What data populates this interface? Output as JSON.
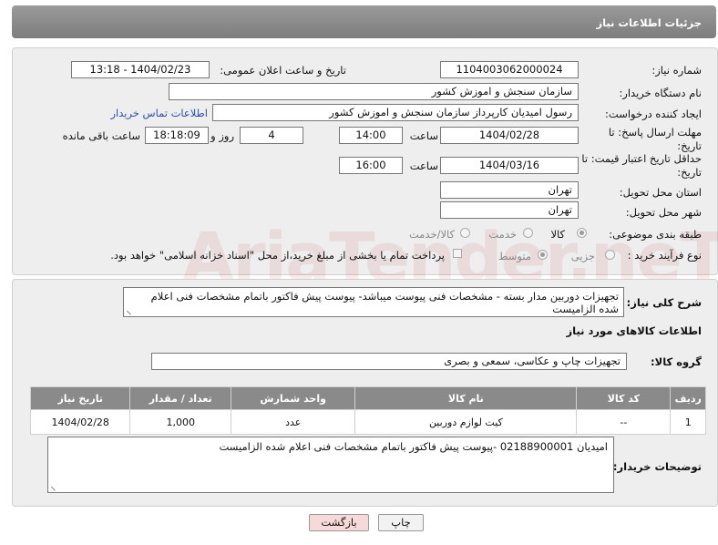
{
  "header": {
    "title": "جزئیات اطلاعات نیاز"
  },
  "form": {
    "need_number_label": "شماره نیاز:",
    "need_number": "1104003062000024",
    "announce_datetime_label": "تاریخ و ساعت اعلان عمومی:",
    "announce_datetime": "1404/02/23 - 13:18",
    "buyer_org_label": "نام دستگاه خریدار:",
    "buyer_org": "سازمان سنجش و اموزش کشور",
    "requester_label": "ایجاد کننده درخواست:",
    "requester": "رسول امیدیان کارپرداز سازمان سنجش و اموزش کشور",
    "buyer_contact_link": "اطلاعات تماس خریدار",
    "reply_deadline_label": "مهلت ارسال پاسخ: تا تاریخ:",
    "reply_deadline_date": "1404/02/28",
    "time_label": "ساعت",
    "reply_deadline_time": "14:00",
    "days_value": "4",
    "days_label": "روز و",
    "remaining_time": "18:18:09",
    "remaining_label": "ساعت باقی مانده",
    "price_validity_label": "حداقل تاریخ اعتبار قیمت: تا تاریخ:",
    "price_validity_date": "1404/03/16",
    "price_validity_time": "16:00",
    "delivery_province_label": "استان محل تحویل:",
    "delivery_province": "تهران",
    "delivery_city_label": "شهر محل تحویل:",
    "delivery_city": "تهران",
    "category_label": "طبقه بندی موضوعی:",
    "category_options": [
      "کالا",
      "خدمت",
      "کالا/خدمت"
    ],
    "category_selected": "کالا",
    "process_label": "نوع فرآیند خرید :",
    "process_options": [
      "جزیی",
      "متوسط"
    ],
    "process_selected": "متوسط",
    "payment_note": "پرداخت تمام یا بخشی از مبلغ خرید،از محل \"اسناد خزانه اسلامی\" خواهد بود."
  },
  "details": {
    "description_label": "شرح کلی نیاز:",
    "description": "تجهیزات دوربین مدار بسته - مشخصات فنی پیوست میباشد- پیوست پیش فاکتور باتمام مشخصات فنی اعلام شده الزامیست",
    "goods_info_title": "اطلاعات کالاهای مورد نیاز",
    "goods_group_label": "گروه کالا:",
    "goods_group": "تجهیزات چاپ و عکاسی، سمعی و بصری",
    "table": {
      "headers": [
        "ردیف",
        "کد کالا",
        "نام کالا",
        "واحد شمارش",
        "تعداد / مقدار",
        "تاریخ نیاز"
      ],
      "rows": [
        [
          "1",
          "--",
          "کیت لوازم دوربین",
          "عدد",
          "1,000",
          "1404/02/28"
        ]
      ]
    },
    "buyer_notes_label": "توضیحات خریدار:",
    "buyer_notes": "امیدیان 02188900001 -پیوست پیش فاکتور باتمام مشخصات فنی اعلام شده الزامیست"
  },
  "buttons": {
    "print": "چاپ",
    "back": "بازگشت"
  },
  "watermark": "AriaTender.neT",
  "colors": {
    "header_bg": "#8a8a8a",
    "panel_bg": "#eeeeee",
    "link": "#2a4fb5",
    "back_button_bg": "#f7d9d9"
  }
}
